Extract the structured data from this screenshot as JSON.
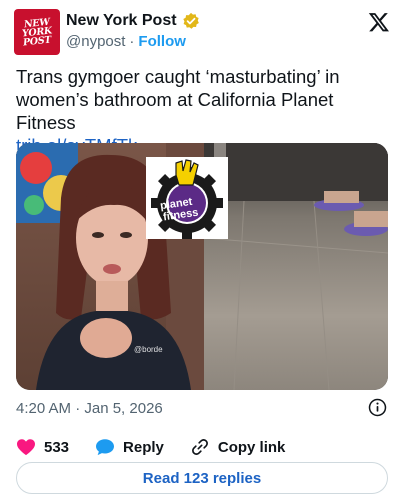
{
  "account": {
    "name": "New York Post",
    "handle": "@nypost",
    "separator": "·",
    "follow_label": "Follow",
    "avatar_lines": [
      "NEW",
      "YORK",
      "POST"
    ]
  },
  "tweet": {
    "text": "Trans gymgoer caught ‘masturbating’ in women’s bathroom at California Planet Fitness",
    "link": "trib.al/svTMfTk"
  },
  "media": {
    "overlay_caption": "@borde",
    "logo_lines": [
      "planet",
      "fitness"
    ]
  },
  "meta": {
    "timestamp": "4:20 AM · Jan 5, 2026"
  },
  "actions": {
    "likes": "533",
    "reply_label": "Reply",
    "copy_link_label": "Copy link"
  },
  "read_replies_label": "Read 123 replies",
  "colors": {
    "brand_red": "#c8102e",
    "link_blue": "#1d63c4",
    "like_pink": "#f91880",
    "reply_blue": "#1d9bf0",
    "verified_gold": "#e2b719"
  }
}
